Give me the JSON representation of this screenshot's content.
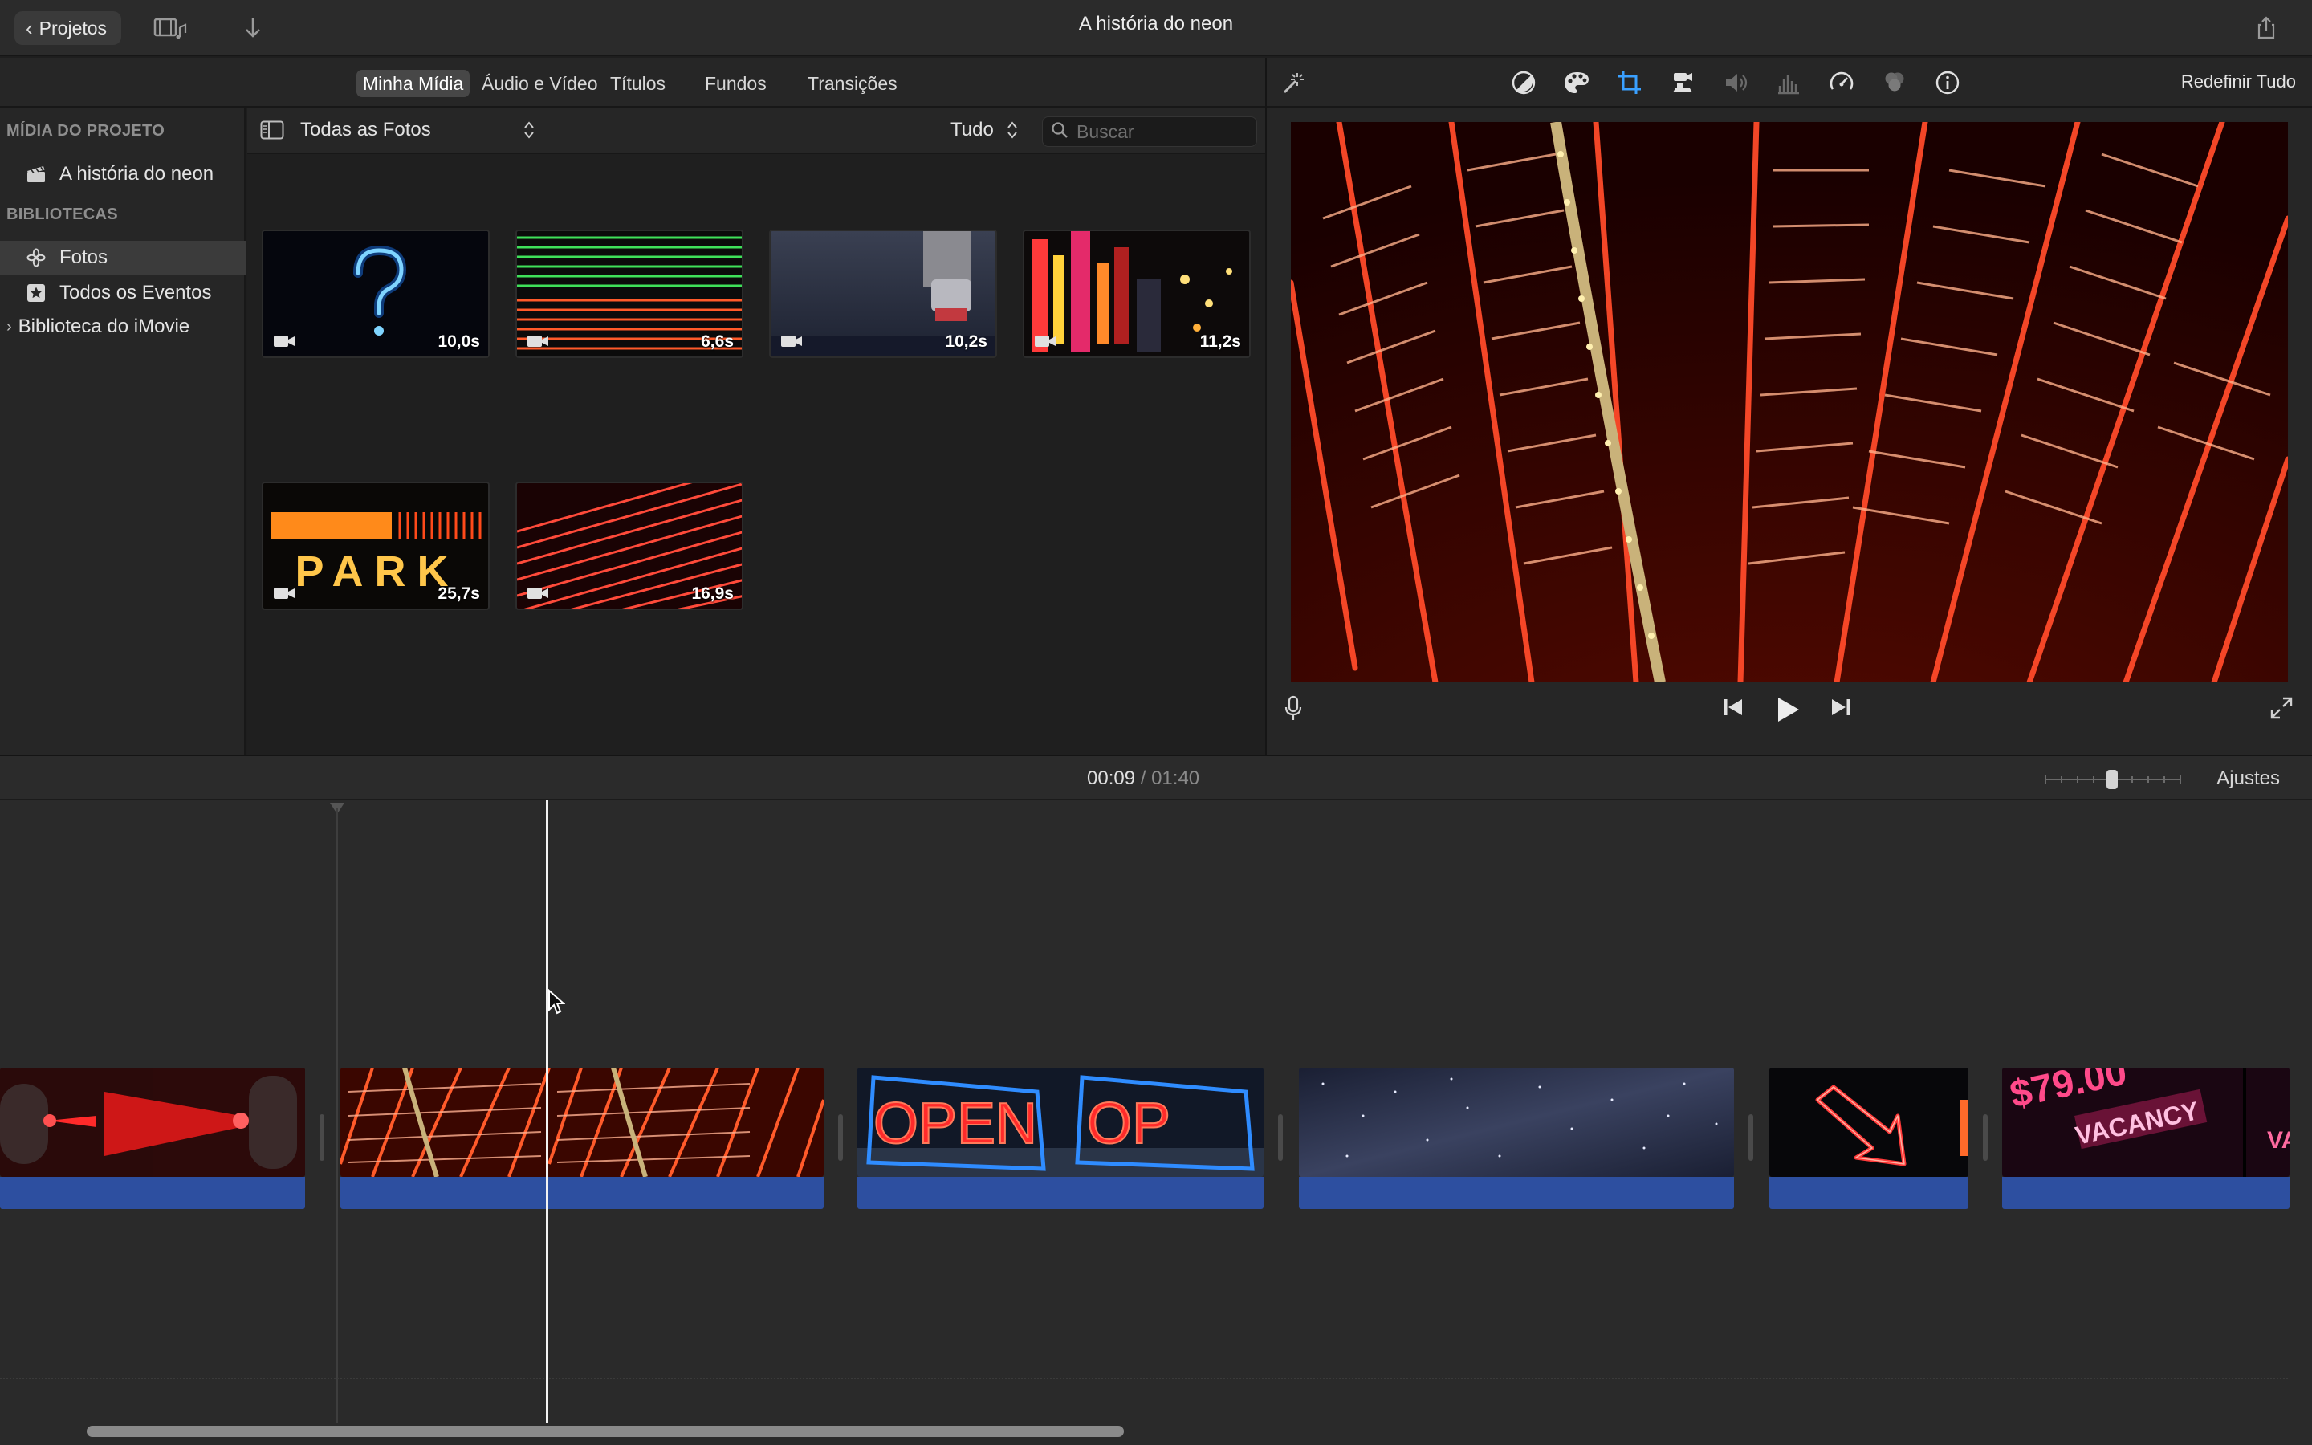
{
  "toolbar": {
    "back_label": "Projetos",
    "window_title": "A história do neon"
  },
  "browser": {
    "tabs": [
      {
        "label": "Minha Mídia",
        "active": true
      },
      {
        "label": "Áudio e Vídeo",
        "active": false
      },
      {
        "label": "Títulos",
        "active": false
      },
      {
        "label": "Fundos",
        "active": false
      },
      {
        "label": "Transições",
        "active": false
      }
    ],
    "filter": {
      "collection": "Todas as Fotos",
      "scope": "Tudo",
      "search_placeholder": "Buscar"
    },
    "clips": [
      {
        "duration": "10,0s",
        "subject": "question-mark"
      },
      {
        "duration": "6,6s",
        "subject": "green-red-lines"
      },
      {
        "duration": "10,2s",
        "subject": "machine"
      },
      {
        "duration": "11,2s",
        "subject": "city-night"
      },
      {
        "duration": "25,7s",
        "subject": "park-sign",
        "sign_text": "PARK"
      },
      {
        "duration": "16,9s",
        "subject": "red-diagonal-lines"
      }
    ]
  },
  "sidebar": {
    "project_header": "MÍDIA DO PROJETO",
    "project_item": "A história do neon",
    "libraries_header": "BIBLIOTECAS",
    "items": [
      {
        "label": "Fotos",
        "icon": "photos-icon",
        "selected": true
      },
      {
        "label": "Todos os Eventos",
        "icon": "star-icon",
        "selected": false
      },
      {
        "label": "Biblioteca do iMovie",
        "icon": "disclosure-icon",
        "selected": false
      }
    ]
  },
  "viewer": {
    "reset_label": "Redefinir Tudo",
    "adjust_icons": [
      "color-balance-icon",
      "color-correction-icon",
      "crop-icon",
      "stabilization-icon",
      "volume-icon",
      "equalizer-icon",
      "speed-icon",
      "noise-reduction-icon",
      "info-icon"
    ]
  },
  "timeline": {
    "current_time": "00:09",
    "separator": "/",
    "total_time": "01:40",
    "settings_label": "Ajustes",
    "clips": [
      {
        "subject": "red-laser"
      },
      {
        "subject": "neon-ceiling",
        "selected_under_playhead": true
      },
      {
        "subject": "open-sign",
        "sign_text": "OPEN"
      },
      {
        "subject": "starry-sky"
      },
      {
        "subject": "neon-arrow"
      },
      {
        "subject": "vacancy-sign",
        "sign_text": "$79.00 VACANCY"
      }
    ]
  },
  "colors": {
    "accent_audio": "#2d4fa0",
    "neon_red": "#ff3a22",
    "neon_blue": "#2f8cff"
  }
}
